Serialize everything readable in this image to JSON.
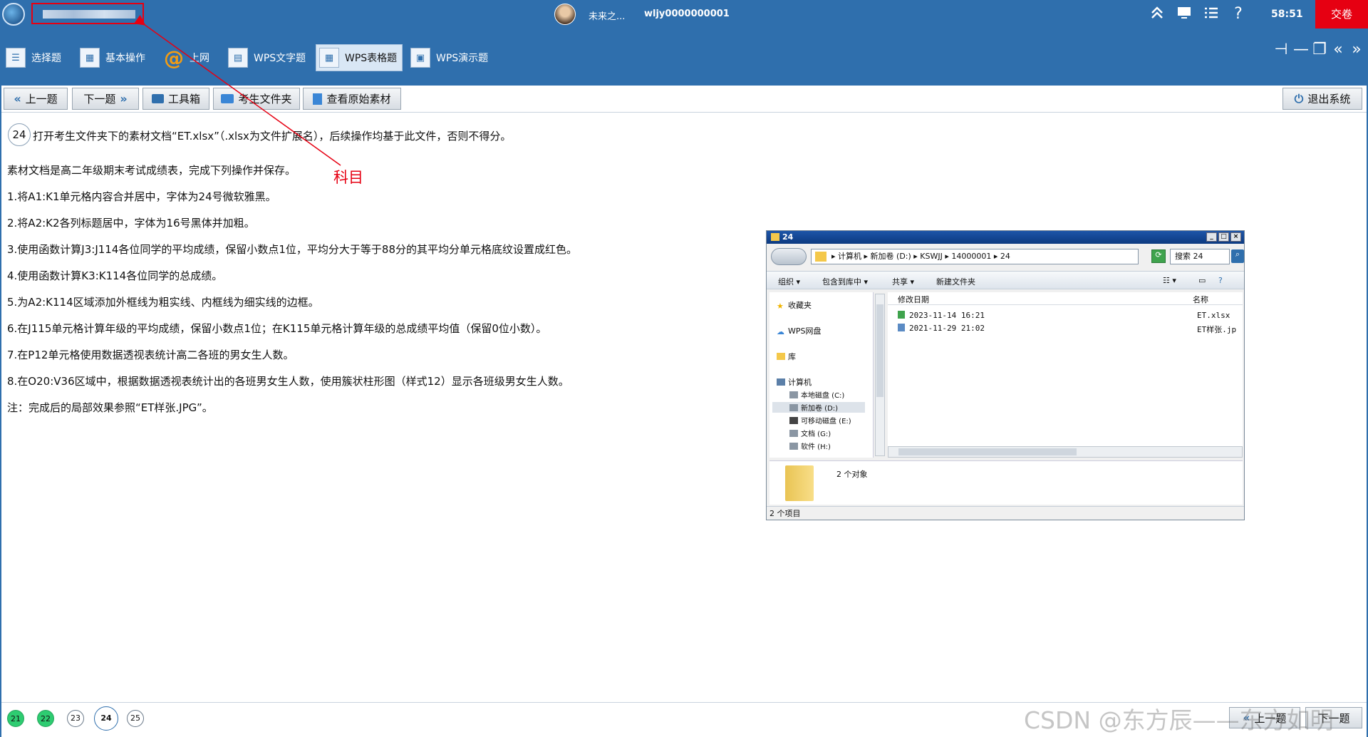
{
  "titlebar": {
    "username": "未来之...",
    "user_id": "wljy0000000001",
    "timer": "58:51",
    "submit_label": "交卷"
  },
  "categories": [
    {
      "label": "选择题",
      "icon": "list-icon"
    },
    {
      "label": "基本操作",
      "icon": "grid-icon"
    },
    {
      "label": "上网",
      "icon": "at-icon"
    },
    {
      "label": "WPS文字题",
      "icon": "document-icon"
    },
    {
      "label": "WPS表格题",
      "icon": "spreadsheet-icon",
      "active": true
    },
    {
      "label": "WPS演示题",
      "icon": "presentation-icon"
    }
  ],
  "toolbar": {
    "prev_label": "上一题",
    "next_label": "下一题",
    "toolbox_label": "工具箱",
    "folder_label": "考生文件夹",
    "material_label": "查看原始素材",
    "exit_label": "退出系统"
  },
  "question": {
    "number": "24",
    "lines": [
      "打开考生文件夹下的素材文档“ET.xlsx”（.xlsx为文件扩展名），后续操作均基于此文件，否则不得分。",
      "素材文档是高二年级期末考试成绩表，完成下列操作并保存。",
      "1.将A1:K1单元格内容合并居中，字体为24号微软雅黑。",
      "2.将A2:K2各列标题居中，字体为16号黑体并加粗。",
      "3.使用函数计算J3:J114各位同学的平均成绩，保留小数点1位，平均分大于等于88分的其平均分单元格底纹设置成红色。",
      "4.使用函数计算K3:K114各位同学的总成绩。",
      "5.为A2:K114区域添加外框线为粗实线、内框线为细实线的边框。",
      "6.在J115单元格计算年级的平均成绩，保留小数点1位；在K115单元格计算年级的总成绩平均值（保留0位小数）。",
      "7.在P12单元格使用数据透视表统计高二各班的男女生人数。",
      "8.在O20:V36区域中，根据数据透视表统计出的各班男女生人数，使用簇状柱形图（样式12）显示各班级男女生人数。",
      "注：完成后的局部效果参照“ET样张.JPG”。"
    ]
  },
  "annotation": {
    "label": "科目",
    "color": "#e60012"
  },
  "explorer": {
    "title": "24",
    "path": "▸ 计算机 ▸ 新加卷 (D:) ▸ KSWJJ ▸ 14000001 ▸ 24",
    "search_placeholder": "搜索 24",
    "commands": [
      "组织 ▾",
      "包含到库中 ▾",
      "共享 ▾",
      "新建文件夹"
    ],
    "nav_items": [
      {
        "label": "收藏夹",
        "level": 0
      },
      {
        "label": "WPS网盘",
        "level": 0
      },
      {
        "label": "库",
        "level": 0
      },
      {
        "label": "计算机",
        "level": 0
      },
      {
        "label": "本地磁盘 (C:)",
        "level": 1
      },
      {
        "label": "新加卷 (D:)",
        "level": 1,
        "selected": true
      },
      {
        "label": "可移动磁盘 (E:)",
        "level": 1
      },
      {
        "label": "文档 (G:)",
        "level": 1
      },
      {
        "label": "软件 (H:)",
        "level": 1
      }
    ],
    "columns": {
      "date": "修改日期",
      "name": "名称"
    },
    "files": [
      {
        "date": "2023-11-14 16:21",
        "name": "ET.xlsx",
        "icon": "xlsx-file-icon"
      },
      {
        "date": "2021-11-29 21:02",
        "name": "ET样张.jp",
        "icon": "image-file-icon"
      }
    ],
    "details_count": "2 个对象",
    "status": "2 个项目"
  },
  "question_nav": [
    {
      "label": "21",
      "state": "done"
    },
    {
      "label": "22",
      "state": "done"
    },
    {
      "label": "23",
      "state": "todo"
    },
    {
      "label": "24",
      "state": "current"
    },
    {
      "label": "25",
      "state": "todo"
    }
  ],
  "bottom": {
    "prev_label": "上一题",
    "next_label": "下一题",
    "watermark": "CSDN @东方辰——东方如明"
  },
  "colors": {
    "primary": "#2f6fad",
    "danger": "#e60012",
    "done": "#2ecc71"
  }
}
